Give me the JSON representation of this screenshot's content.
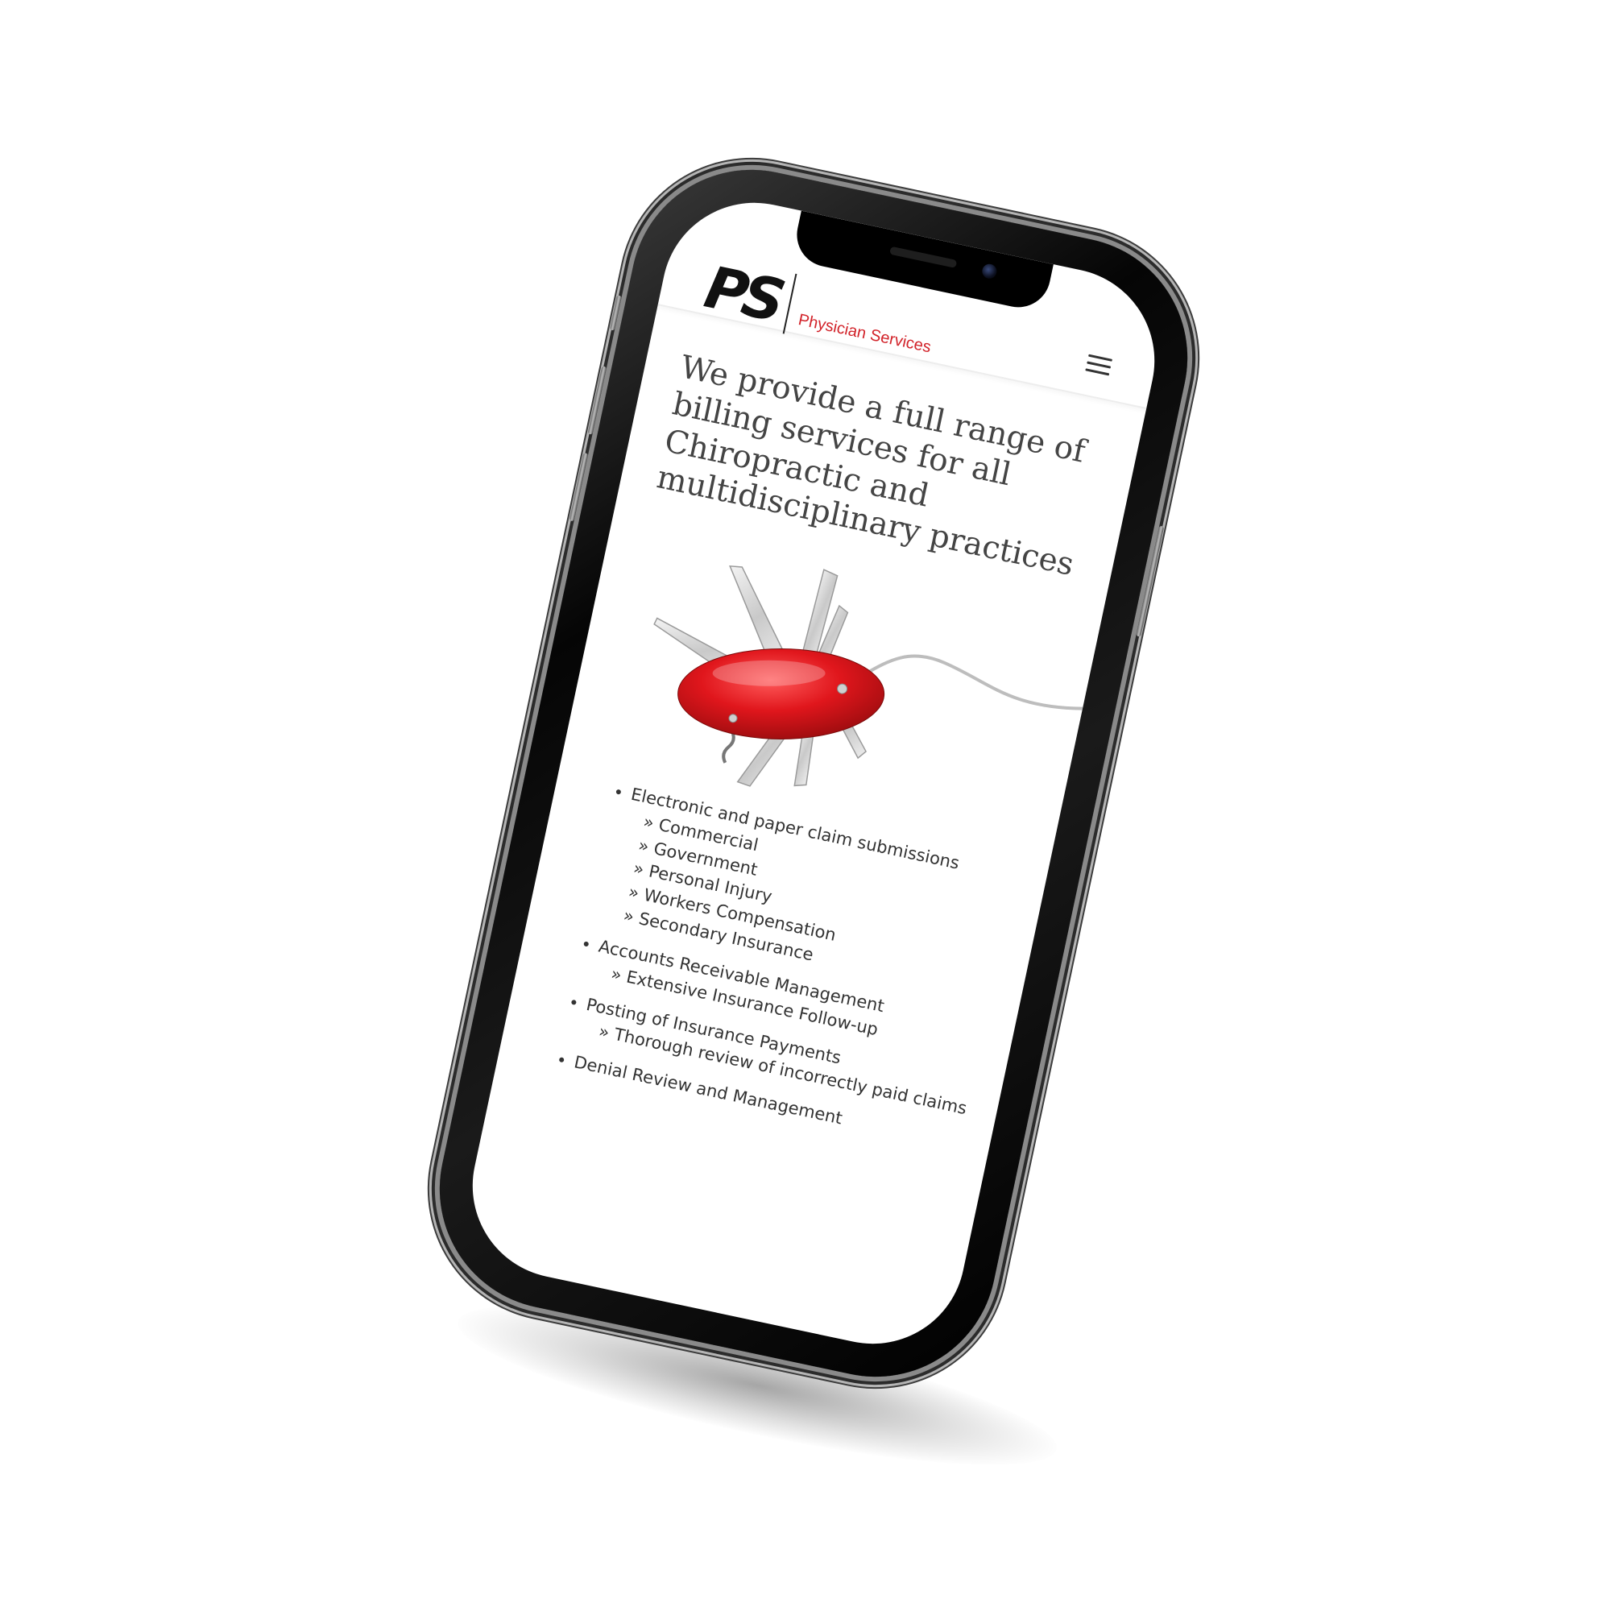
{
  "header": {
    "logo_mark": "PS",
    "logo_text": "Physician Services",
    "brand_color": "#d2232a",
    "menu_icon": "hamburger-menu-icon"
  },
  "hero": {
    "title": "We provide a full range of billing services for all Chiropractic and multidisciplinary practices",
    "illustration": "red-swiss-army-knife-computer-mouse"
  },
  "services": [
    {
      "label": "Electronic and paper claim submissions",
      "sub": [
        "Commercial",
        "Government",
        "Personal Injury",
        "Workers Compensation",
        "Secondary Insurance"
      ]
    },
    {
      "label": "Accounts Receivable Management",
      "sub": [
        "Extensive Insurance Follow-up"
      ]
    },
    {
      "label": "Posting of Insurance Payments",
      "sub": [
        "Thorough review of incorrectly paid claims"
      ]
    },
    {
      "label": "Denial Review and Management",
      "sub": []
    }
  ]
}
